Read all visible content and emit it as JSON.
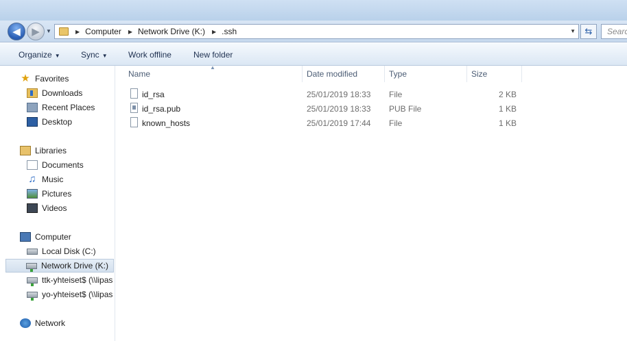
{
  "address": {
    "crumbs": [
      "Computer",
      "Network Drive (K:)",
      ".ssh"
    ],
    "search_placeholder": "Search"
  },
  "toolbar": {
    "organize": "Organize",
    "sync": "Sync",
    "work_offline": "Work offline",
    "new_folder": "New folder"
  },
  "sidebar": {
    "favorites": {
      "label": "Favorites",
      "items": [
        "Downloads",
        "Recent Places",
        "Desktop"
      ]
    },
    "libraries": {
      "label": "Libraries",
      "items": [
        "Documents",
        "Music",
        "Pictures",
        "Videos"
      ]
    },
    "computer": {
      "label": "Computer",
      "items": [
        "Local Disk (C:)",
        "Network Drive (K:)",
        "ttk-yhteiset$ (\\\\lipas",
        "yo-yhteiset$ (\\\\lipas"
      ],
      "selected": "Network Drive (K:)"
    },
    "network": {
      "label": "Network"
    }
  },
  "columns": {
    "name": "Name",
    "date": "Date modified",
    "type": "Type",
    "size": "Size"
  },
  "files": [
    {
      "name": "id_rsa",
      "date": "25/01/2019 18:33",
      "type": "File",
      "size": "2 KB"
    },
    {
      "name": "id_rsa.pub",
      "date": "25/01/2019 18:33",
      "type": "PUB File",
      "size": "1 KB"
    },
    {
      "name": "known_hosts",
      "date": "25/01/2019 17:44",
      "type": "File",
      "size": "1 KB"
    }
  ],
  "colors": {
    "accent": "#2b5fb4",
    "selection": "#d3e0ee"
  }
}
